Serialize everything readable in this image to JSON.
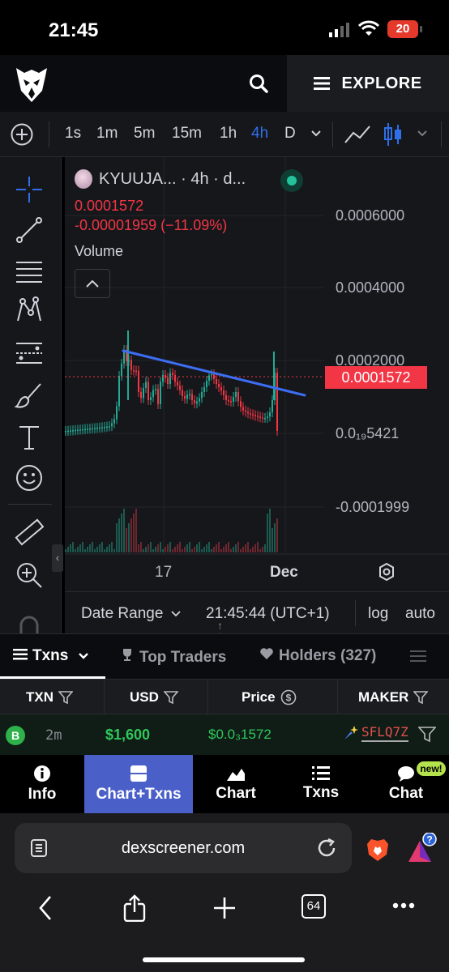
{
  "status_bar": {
    "time": "21:45",
    "battery": "20"
  },
  "header": {
    "explore_label": "EXPLORE"
  },
  "toolbar": {
    "intervals": [
      "1s",
      "1m",
      "5m",
      "15m",
      "1h",
      "4h",
      "D"
    ],
    "active_interval": "4h"
  },
  "chart": {
    "legend_title": "KYUUJA... · 4h · d...",
    "price": "0.0001572",
    "change": "-0.00001959 (−11.09%)",
    "volume_label": "Volume",
    "y_labels": [
      "0.0006000",
      "0.0004000",
      "0.0002000",
      "0.0₁₉5421",
      "-0.0001999"
    ],
    "current_price_tag": "0.0001572",
    "x_labels": [
      "17",
      "Dec"
    ]
  },
  "chart_data": {
    "type": "candlestick",
    "interval": "4h",
    "y_ticks": [
      0.0006,
      0.0004,
      0.0002,
      0.0,
      -0.0001999
    ],
    "last_price": 0.0001572,
    "x_ticks": [
      "17",
      "Dec"
    ],
    "annotations": [
      "blue descending trendline"
    ]
  },
  "range_bar": {
    "date_range": "Date Range",
    "timezone": "21:45:44 (UTC+1)",
    "log": "log",
    "auto": "auto"
  },
  "tabs": {
    "txns": "Txns",
    "top_traders": "Top Traders",
    "holders": "Holders (327)"
  },
  "table": {
    "headers": {
      "txn": "TXN",
      "usd": "USD",
      "price": "Price",
      "maker": "MAKER"
    },
    "rows": [
      {
        "type": "B",
        "age": "2m",
        "usd": "$1,600",
        "price": "$0.0₃1572",
        "maker": "SFLQ7Z"
      }
    ]
  },
  "bottom_nav": {
    "items": [
      "Info",
      "Chart+Txns",
      "Chart",
      "Txns",
      "Chat"
    ],
    "active": "Chart+Txns",
    "chat_badge": "new!"
  },
  "browser": {
    "url": "dexscreener.com",
    "tab_count": "64"
  },
  "colors": {
    "accent": "#2f6fea",
    "down": "#f23645",
    "up": "#22ab94",
    "active_nav": "#4a5fc8"
  }
}
